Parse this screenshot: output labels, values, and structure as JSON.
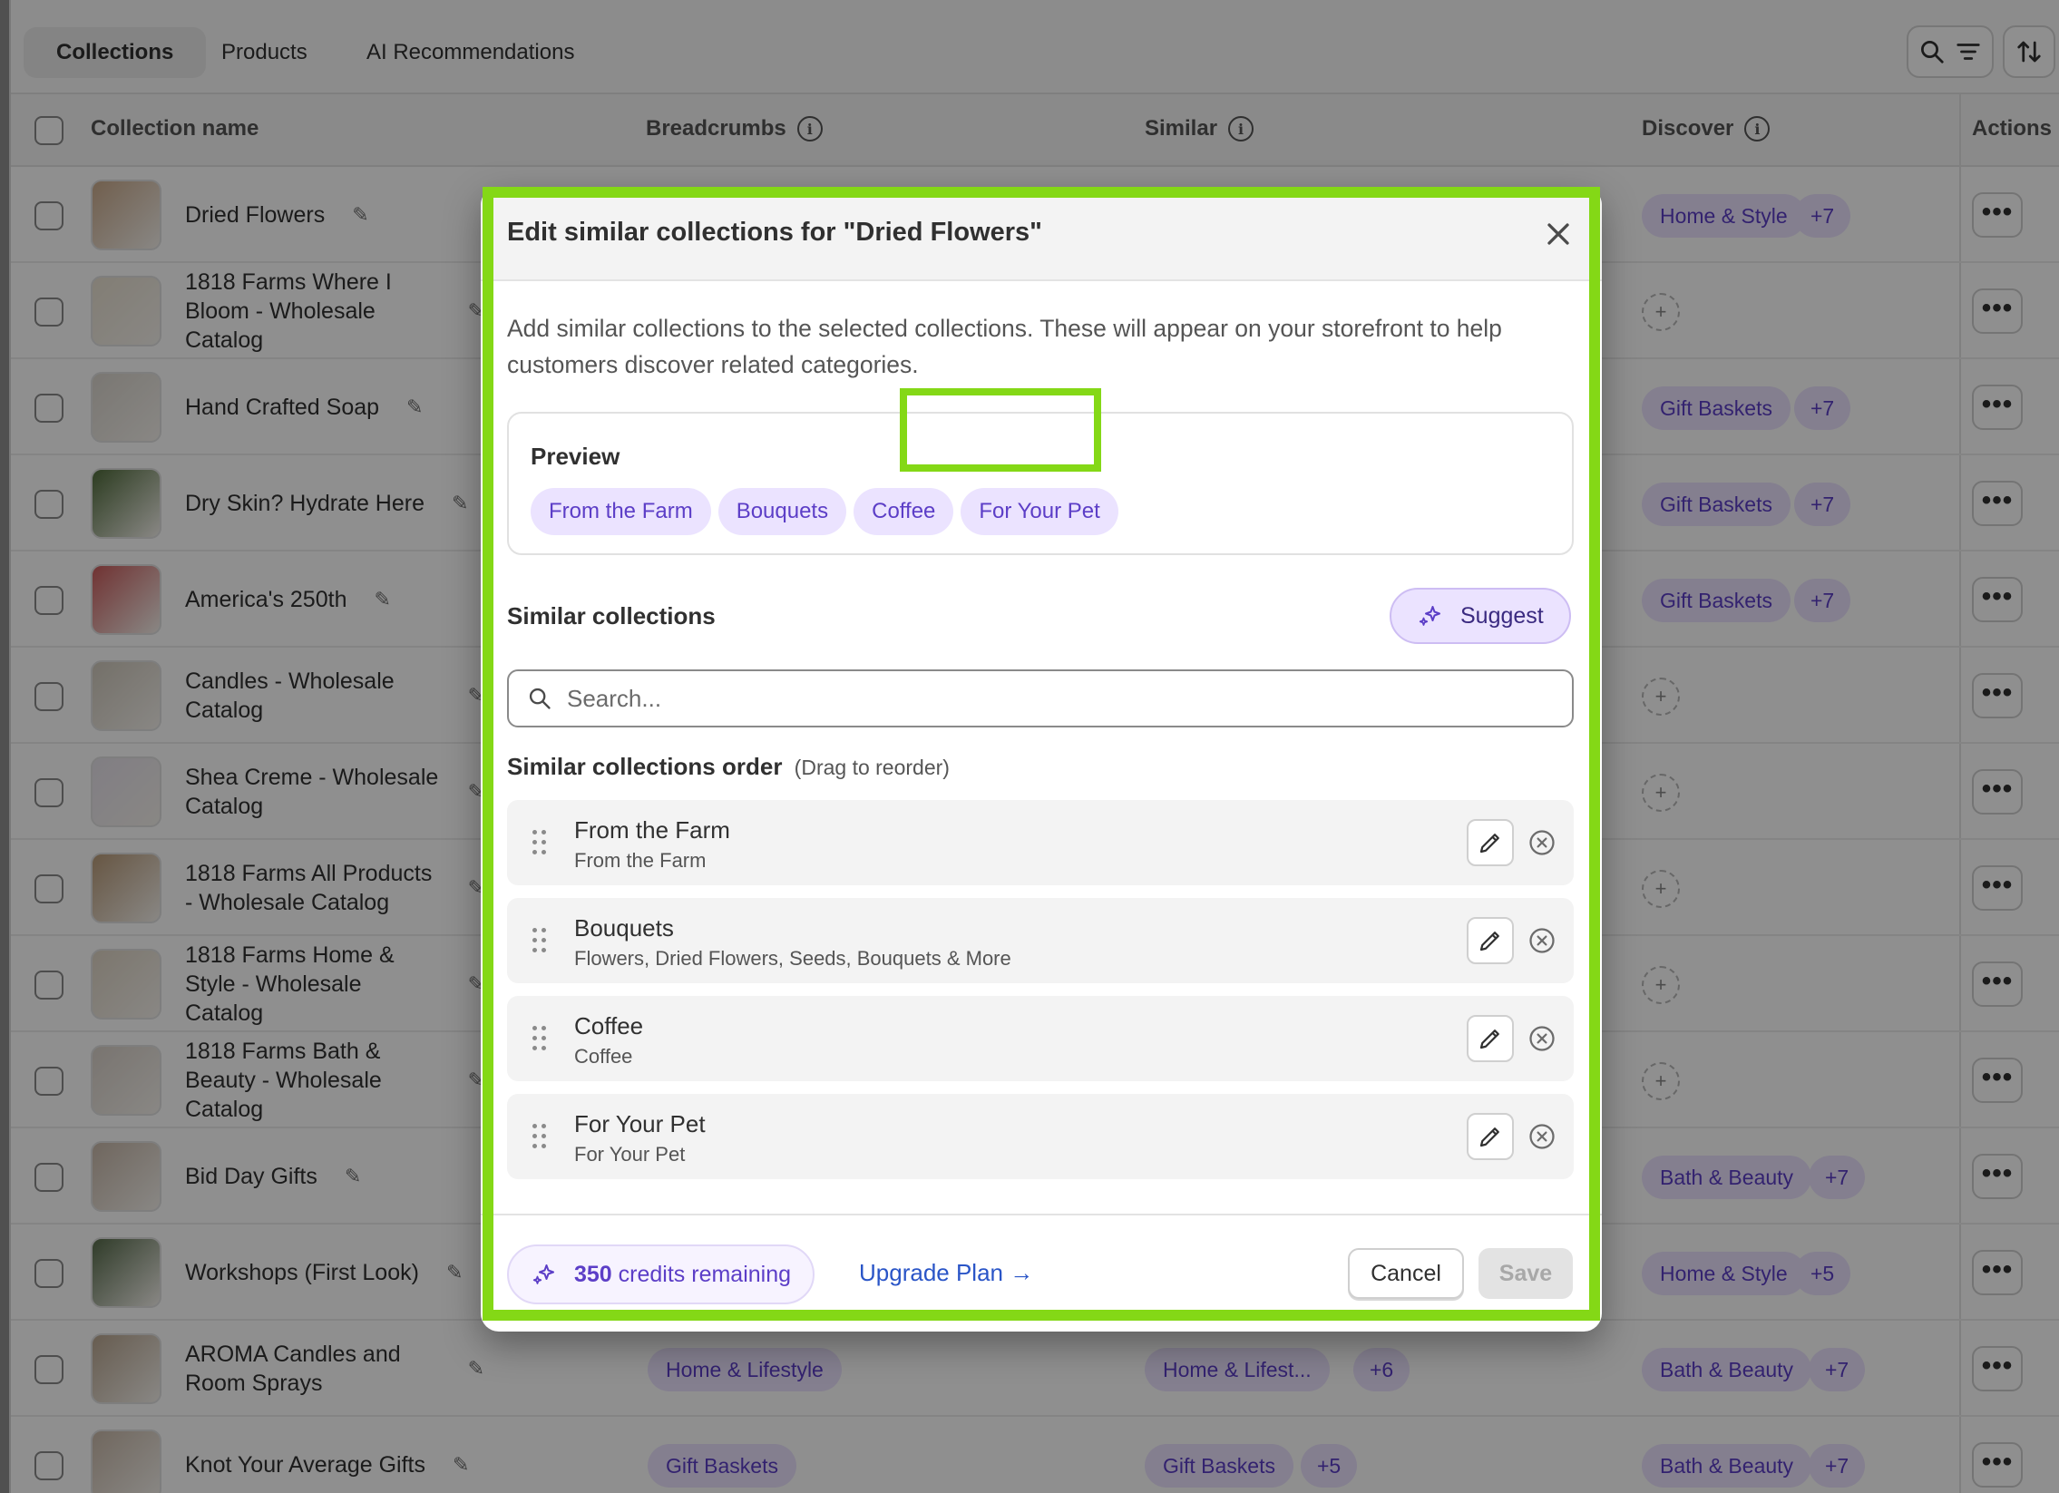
{
  "tabs": [
    "Collections",
    "Products",
    "AI Recommendations"
  ],
  "columns": {
    "name": "Collection name",
    "breadcrumbs": "Breadcrumbs",
    "similar": "Similar",
    "discover": "Discover",
    "actions": "Actions"
  },
  "rows": [
    {
      "name": "Dried Flowers",
      "discover": [
        "Home & Style",
        "+7"
      ]
    },
    {
      "name": "1818 Farms Where I Bloom - Wholesale Catalog",
      "discover": []
    },
    {
      "name": "Hand Crafted Soap",
      "discover": [
        "Gift Baskets",
        "+7"
      ]
    },
    {
      "name": "Dry Skin? Hydrate Here",
      "discover": [
        "Gift Baskets",
        "+7"
      ]
    },
    {
      "name": "America's 250th",
      "discover": [
        "Gift Baskets",
        "+7"
      ]
    },
    {
      "name": "Candles - Wholesale Catalog",
      "discover": []
    },
    {
      "name": "Shea Creme - Wholesale Catalog",
      "discover": []
    },
    {
      "name": "1818 Farms All Products - Wholesale Catalog",
      "discover": []
    },
    {
      "name": "1818 Farms Home & Style - Wholesale Catalog",
      "discover": []
    },
    {
      "name": "1818 Farms Bath & Beauty - Wholesale Catalog",
      "discover": []
    },
    {
      "name": "Bid Day Gifts",
      "discover": [
        "Bath & Beauty",
        "+7"
      ]
    },
    {
      "name": "Workshops (First Look)",
      "discover": [
        "Home & Style",
        "+5"
      ]
    },
    {
      "name": "AROMA Candles and Room Sprays",
      "breadcrumbs": "Home & Lifestyle",
      "similar": [
        "Home & Lifest...",
        "+6"
      ],
      "discover": [
        "Bath & Beauty",
        "+7"
      ]
    },
    {
      "name": "Knot Your Average Gifts",
      "breadcrumbs": "Gift Baskets",
      "similar": [
        "Gift Baskets",
        "+5"
      ],
      "discover": [
        "Bath & Beauty",
        "+7"
      ]
    }
  ],
  "modal": {
    "title": "Edit similar collections for \"Dried Flowers\"",
    "description": "Add similar collections to the selected collections. These will appear on your storefront to help customers discover related categories.",
    "preview_title": "Preview",
    "preview_chips": [
      "From the Farm",
      "Bouquets",
      "Coffee",
      "For Your Pet"
    ],
    "similar_title": "Similar collections",
    "suggest_label": "Suggest",
    "search_placeholder": "Search...",
    "order_title": "Similar collections order",
    "order_hint": "(Drag to reorder)",
    "items": [
      {
        "name": "From the Farm",
        "sub": "From the Farm"
      },
      {
        "name": "Bouquets",
        "sub": "Flowers, Dried Flowers, Seeds, Bouquets & More"
      },
      {
        "name": "Coffee",
        "sub": "Coffee"
      },
      {
        "name": "For Your Pet",
        "sub": "For Your Pet"
      }
    ],
    "credits_count": "350",
    "credits_label": "credits remaining",
    "upgrade_label": "Upgrade Plan →",
    "cancel_label": "Cancel",
    "save_label": "Save"
  },
  "colors": {
    "accent": "#84d816",
    "chip_bg": "#ebe3ff",
    "chip_text": "#5c3ec7",
    "link": "#2a55c7"
  },
  "icons": [
    "search-icon",
    "filter-icon",
    "sort-icon",
    "info-icon",
    "edit-icon",
    "close-icon",
    "sparkle-icon",
    "drag-handle-icon",
    "remove-icon",
    "more-icon"
  ]
}
